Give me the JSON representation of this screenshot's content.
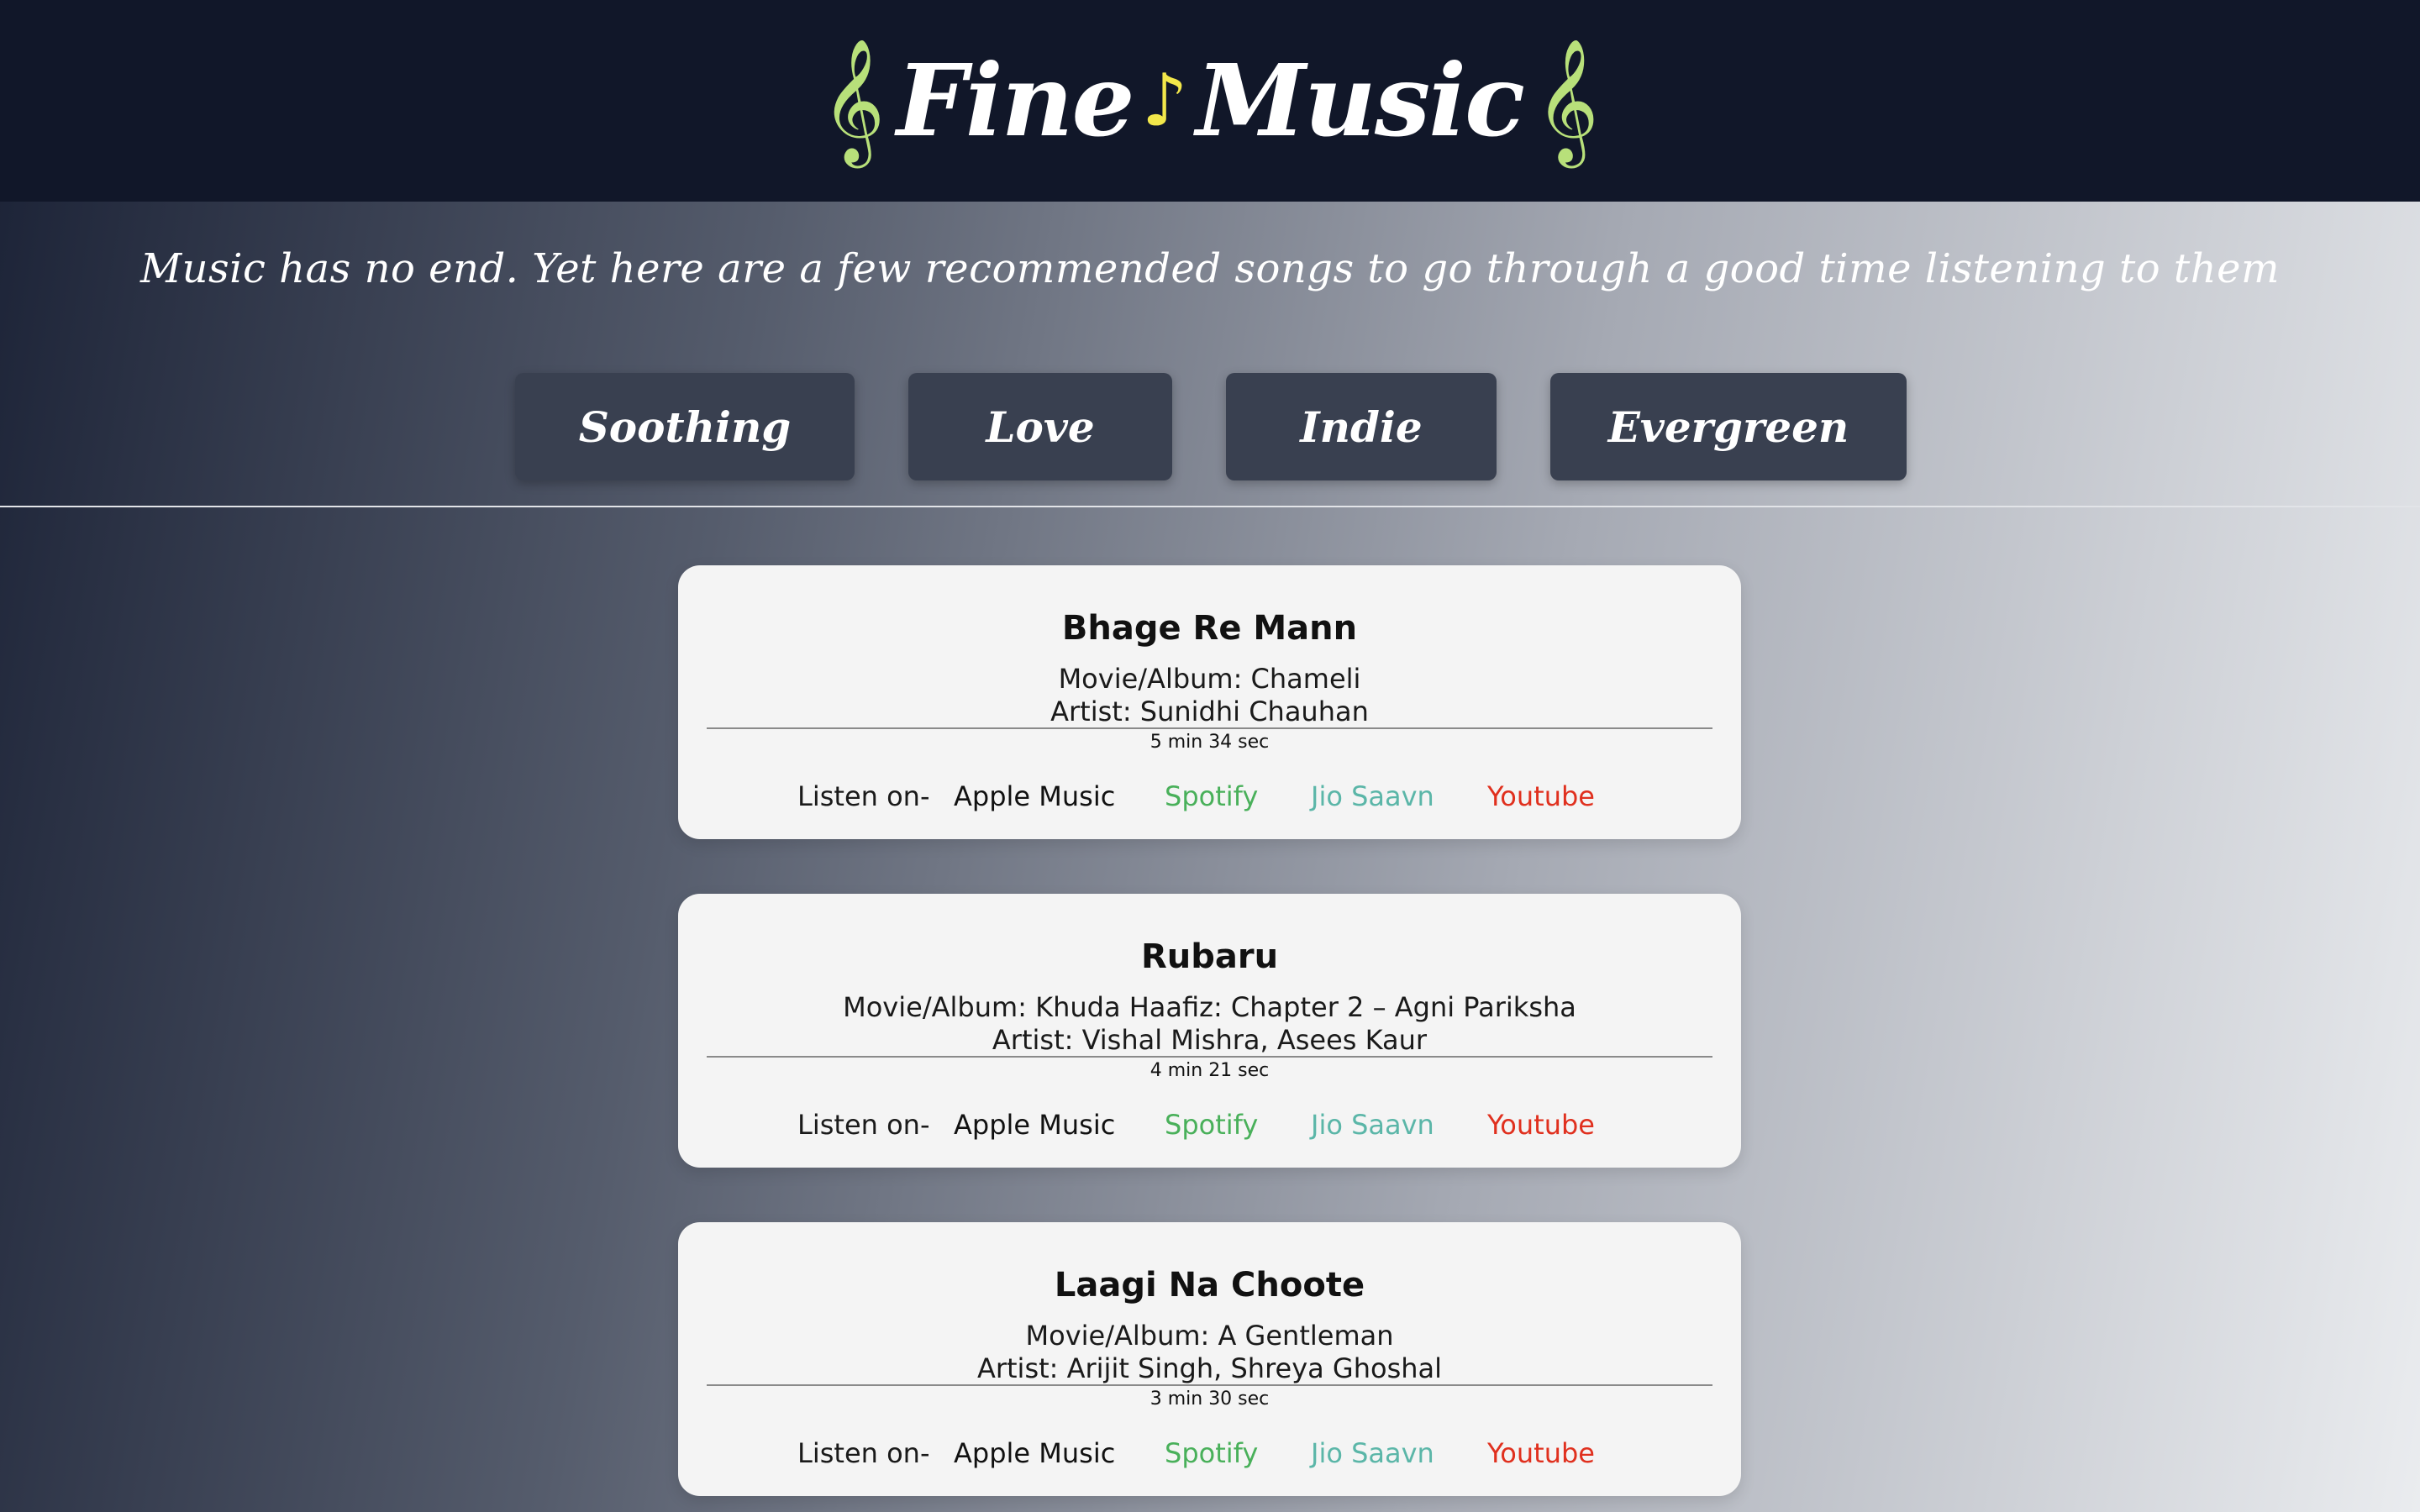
{
  "header": {
    "logo_left_icon": "treble-clef-icon",
    "logo_word_1": "Fine",
    "logo_note_icon": "music-note-icon",
    "logo_word_2": "Music",
    "logo_right_icon": "treble-clef-icon",
    "colors": {
      "background": "#111729",
      "clef": "#b8e07a",
      "note": "#f2e74a"
    }
  },
  "tagline": "Music has no end. Yet here are a few recommended songs to go through a good time listening to them",
  "genres": [
    {
      "label": "Soothing"
    },
    {
      "label": "Love"
    },
    {
      "label": "Indie"
    },
    {
      "label": "Evergreen"
    }
  ],
  "songs": [
    {
      "title": "Bhage Re Mann",
      "album": "Movie/Album: Chameli",
      "artist": "Artist: Sunidhi Chauhan",
      "duration": "5 min 34 sec",
      "listen_label": "Listen on-",
      "links": {
        "apple": "Apple Music",
        "spotify": "Spotify",
        "jio": "Jio Saavn",
        "youtube": "Youtube"
      }
    },
    {
      "title": "Rubaru",
      "album": "Movie/Album: Khuda Haafiz: Chapter 2 – Agni Pariksha",
      "artist": "Artist: Vishal Mishra, Asees Kaur",
      "duration": "4 min 21 sec",
      "listen_label": "Listen on-",
      "links": {
        "apple": "Apple Music",
        "spotify": "Spotify",
        "jio": "Jio Saavn",
        "youtube": "Youtube"
      }
    },
    {
      "title": "Laagi Na Choote",
      "album": "Movie/Album: A Gentleman",
      "artist": "Artist: Arijit Singh, Shreya Ghoshal",
      "duration": "3 min 30 sec",
      "listen_label": "Listen on-",
      "links": {
        "apple": "Apple Music",
        "spotify": "Spotify",
        "jio": "Jio Saavn",
        "youtube": "Youtube"
      }
    }
  ],
  "link_colors": {
    "spotify": "#49b05a",
    "jio": "#5bb6a8",
    "youtube": "#e0301e"
  }
}
